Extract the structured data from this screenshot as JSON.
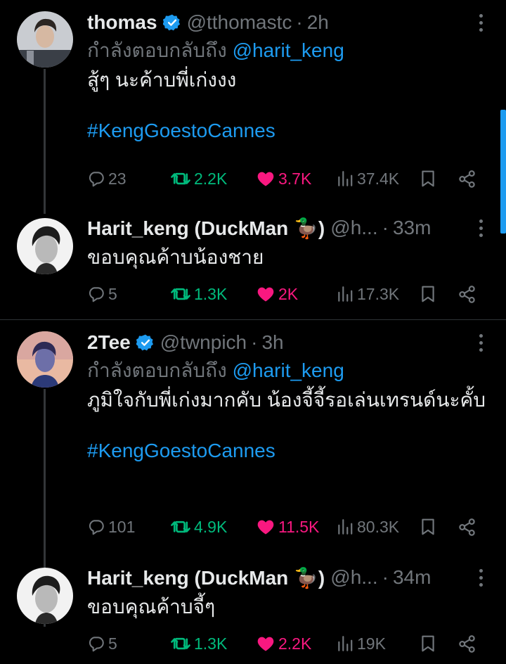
{
  "theme": {
    "accent": "#1d9bf0",
    "retweet_color": "#00ba7c",
    "like_color": "#f91880",
    "muted": "#71767b",
    "background": "#000000"
  },
  "threads": [
    {
      "parent": {
        "name": "thomas",
        "verified": true,
        "handle": "@tthomastc",
        "time": "2h",
        "reply_prefix": "กำลังตอบกลับถึง",
        "reply_mention": "@harit_keng",
        "text": "สู้ๆ นะค้าบพี่เก่งงง",
        "hashtag": "#KengGoestoCannes",
        "stats": {
          "replies": "23",
          "retweets": "2.2K",
          "likes": "3.7K",
          "views": "37.4K"
        },
        "liked": true
      },
      "reply": {
        "name": "Harit_keng (DuckMan 🦆)",
        "handle": "@h...",
        "time": "33m",
        "text": "ขอบคุณค้าบน้องชาย",
        "stats": {
          "replies": "5",
          "retweets": "1.3K",
          "likes": "2K",
          "views": "17.3K"
        },
        "liked": true
      }
    },
    {
      "parent": {
        "name": "2Tee",
        "verified": true,
        "handle": "@twnpich",
        "time": "3h",
        "reply_prefix": "กำลังตอบกลับถึง",
        "reply_mention": "@harit_keng",
        "text": "ภูมิใจกับพี่เก่งมากคับ น้องจี้จี้รอเล่นเทรนด์นะคั้บ",
        "hashtag": "#KengGoestoCannes",
        "stats": {
          "replies": "101",
          "retweets": "4.9K",
          "likes": "11.5K",
          "views": "80.3K"
        },
        "liked": true
      },
      "reply": {
        "name": "Harit_keng (DuckMan 🦆)",
        "handle": "@h...",
        "time": "34m",
        "text": "ขอบคุณค้าบจี้ๆ",
        "stats": {
          "replies": "5",
          "retweets": "1.3K",
          "likes": "2.2K",
          "views": "19K"
        },
        "liked": true
      }
    }
  ]
}
